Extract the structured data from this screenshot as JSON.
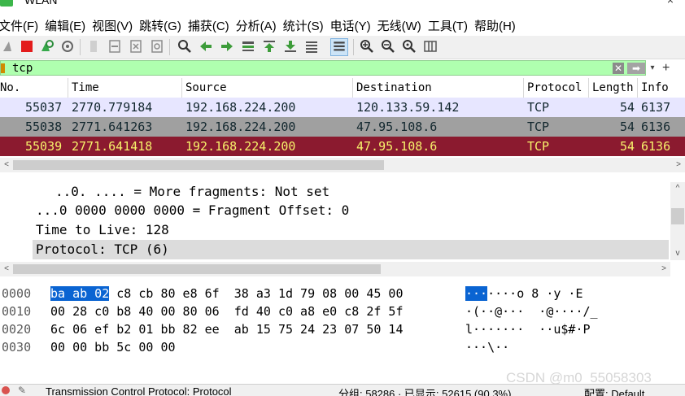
{
  "window": {
    "title": "WLAN",
    "close_glyph": "×"
  },
  "menu": [
    "文件(F)",
    "编辑(E)",
    "视图(V)",
    "跳转(G)",
    "捕获(C)",
    "分析(A)",
    "统计(S)",
    "电话(Y)",
    "无线(W)",
    "工具(T)",
    "帮助(H)"
  ],
  "toolbar": {
    "icons": [
      "shark-fin-icon",
      "stop-capture-icon",
      "restart-capture-icon",
      "capture-options-icon",
      "open-file-icon",
      "save-file-icon",
      "close-file-icon",
      "reload-file-icon",
      "find-packet-icon",
      "go-back-icon",
      "go-forward-icon",
      "go-to-packet-icon",
      "go-first-icon",
      "go-last-icon",
      "autoscroll-icon",
      "colorize-icon",
      "zoom-in-icon",
      "zoom-out-icon",
      "zoom-normal-icon",
      "resize-columns-icon"
    ]
  },
  "filter": {
    "value": "tcp",
    "clear_glyph": "✕",
    "apply_glyph": "➡",
    "dropdown_glyph": "▾",
    "add_glyph": "+"
  },
  "packet_list": {
    "columns": [
      "No.",
      "Time",
      "Source",
      "Destination",
      "Protocol",
      "Length",
      "Info"
    ],
    "rows": [
      {
        "no": "55037",
        "time": "2770.779184",
        "source": "192.168.224.200",
        "destination": "120.133.59.142",
        "protocol": "TCP",
        "length": "54",
        "info": "6137"
      },
      {
        "no": "55038",
        "time": "2771.641263",
        "source": "192.168.224.200",
        "destination": "47.95.108.6",
        "protocol": "TCP",
        "length": "54",
        "info": "6136"
      },
      {
        "no": "55039",
        "time": "2771.641418",
        "source": "192.168.224.200",
        "destination": "47.95.108.6",
        "protocol": "TCP",
        "length": "54",
        "info": "6136"
      }
    ],
    "row_colors": {
      "normal": "#e7e6ff",
      "grey": "#a0a0a0",
      "selected": "#8b1a2f",
      "selected_text": "#f7f26b"
    }
  },
  "scroll_arrows": {
    "left": "<",
    "right": ">",
    "up": "^",
    "down": "v"
  },
  "details": {
    "lines": [
      "..0. .... = More fragments: Not set",
      "...0 0000 0000 0000 = Fragment Offset: 0",
      "Time to Live: 128",
      "Protocol: TCP (6)"
    ]
  },
  "bytes": {
    "rows": [
      {
        "offset": "0000",
        "hex_sel": "ba ab 02",
        "hex_rest": " c8 cb 80 e8 6f  38 a3 1d 79 08 00 45 00",
        "ascii_sel": "···",
        "ascii_rest": "····o 8 ·y ·E"
      },
      {
        "offset": "0010",
        "hex_sel": "",
        "hex_rest": "00 28 c0 b8 40 00 80 06  fd 40 c0 a8 e0 c8 2f 5f",
        "ascii_sel": "",
        "ascii_rest": "·(··@···  ·@····/_"
      },
      {
        "offset": "0020",
        "hex_sel": "",
        "hex_rest": "6c 06 ef b2 01 bb 82 ee  ab 15 75 24 23 07 50 14",
        "ascii_sel": "",
        "ascii_rest": "l·······  ··u$#·P"
      },
      {
        "offset": "0030",
        "hex_sel": "",
        "hex_rest": "00 00 bb 5c 00 00",
        "ascii_sel": "",
        "ascii_rest": "···\\··"
      }
    ]
  },
  "status": {
    "field": "Transmission Control Protocol: Protocol",
    "packets": "分组: 58286 · 已显示: 52615 (90.3%)",
    "profile": "配置: Default"
  },
  "watermark": "CSDN @m0_55058303"
}
